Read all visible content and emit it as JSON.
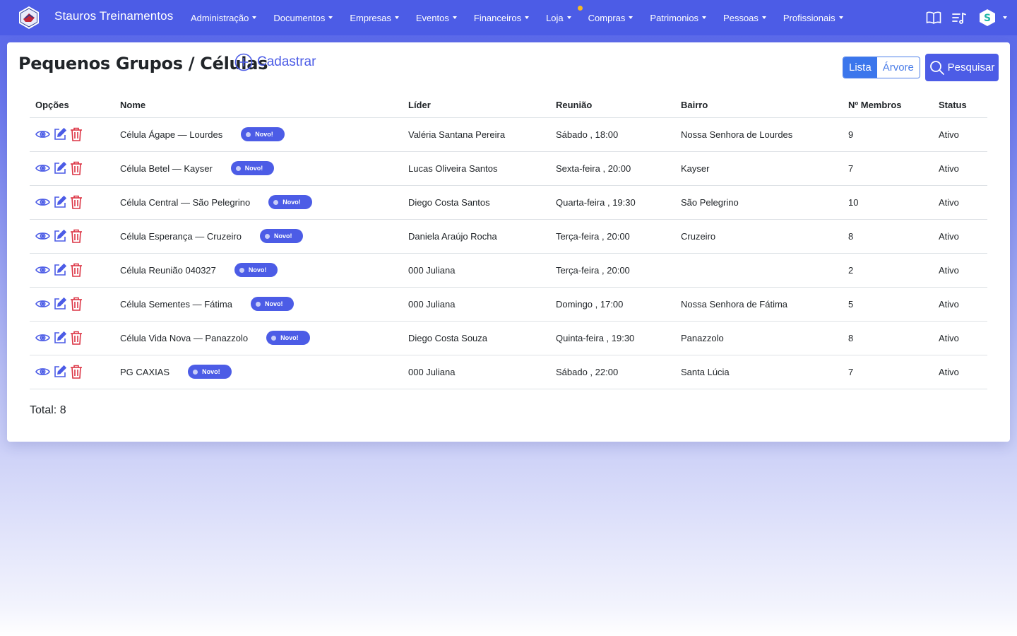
{
  "navbar": {
    "brand": "Stauros Treinamentos",
    "menu": [
      {
        "label": "Administração"
      },
      {
        "label": "Documentos"
      },
      {
        "label": "Empresas"
      },
      {
        "label": "Eventos"
      },
      {
        "label": "Financeiros"
      },
      {
        "label": "Loja",
        "notification": true
      },
      {
        "label": "Compras"
      },
      {
        "label": "Patrimonios"
      },
      {
        "label": "Pessoas"
      },
      {
        "label": "Profissionais"
      }
    ],
    "right_icons": [
      "book-icon",
      "playlist-icon",
      "user-logo-icon"
    ],
    "colors": {
      "bar": "#4c5ce6",
      "notification": "#f7b924"
    }
  },
  "page": {
    "title": "Pequenos Grupos / Células",
    "add_label": "Cadastrar",
    "view_toggle": {
      "list": "Lista",
      "tree": "Árvore",
      "active": "list"
    },
    "search_label": "Pesquisar"
  },
  "table": {
    "headers": {
      "options": "Opções",
      "name": "Nome",
      "leader": "Líder",
      "meeting": "Reunião",
      "neighborhood": "Bairro",
      "members": "Nº Membros",
      "status": "Status"
    },
    "badge_label": "Novo!",
    "rows": [
      {
        "name": "Célula Ágape — Lourdes",
        "leader": "Valéria Santana Pereira",
        "meeting": "Sábado , 18:00",
        "neighborhood": "Nossa Senhora de Lourdes",
        "members": "9",
        "status": "Ativo"
      },
      {
        "name": "Célula Betel — Kayser",
        "leader": "Lucas Oliveira Santos",
        "meeting": "Sexta-feira , 20:00",
        "neighborhood": "Kayser",
        "members": "7",
        "status": "Ativo"
      },
      {
        "name": "Célula Central — São Pelegrino",
        "leader": "Diego Costa Santos",
        "meeting": "Quarta-feira , 19:30",
        "neighborhood": "São Pelegrino",
        "members": "10",
        "status": "Ativo"
      },
      {
        "name": "Célula Esperança — Cruzeiro",
        "leader": "Daniela Araújo Rocha",
        "meeting": "Terça-feira , 20:00",
        "neighborhood": "Cruzeiro",
        "members": "8",
        "status": "Ativo"
      },
      {
        "name": "Célula Reunião 040327",
        "leader": "000 Juliana",
        "meeting": "Terça-feira , 20:00",
        "neighborhood": "",
        "members": "2",
        "status": "Ativo"
      },
      {
        "name": "Célula Sementes — Fátima",
        "leader": "000 Juliana",
        "meeting": "Domingo , 17:00",
        "neighborhood": "Nossa Senhora de Fátima",
        "members": "5",
        "status": "Ativo"
      },
      {
        "name": "Célula Vida Nova — Panazzolo",
        "leader": "Diego Costa Souza",
        "meeting": "Quinta-feira , 19:30",
        "neighborhood": "Panazzolo",
        "members": "8",
        "status": "Ativo"
      },
      {
        "name": "PG CAXIAS",
        "leader": "000 Juliana",
        "meeting": "Sábado , 22:00",
        "neighborhood": "Santa Lúcia",
        "members": "7",
        "status": "Ativo"
      }
    ],
    "row_actions": [
      "view-icon",
      "edit-icon",
      "delete-icon"
    ],
    "colors": {
      "action_blue": "#4c5ce6",
      "delete_red": "#dc3545",
      "badge": "#4c5ce6"
    }
  },
  "footer": {
    "total": "Total: 8"
  }
}
